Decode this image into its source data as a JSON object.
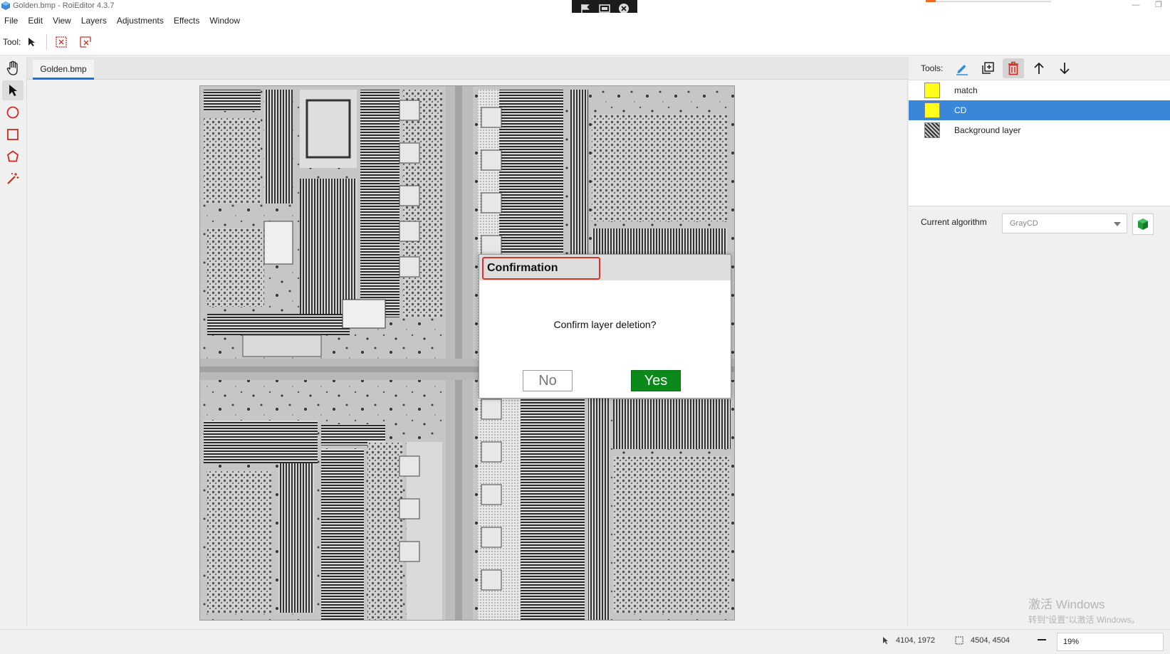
{
  "window": {
    "title": "Golden.bmp - RoiEditor 4.3.7"
  },
  "menubar": {
    "items": [
      "File",
      "Edit",
      "View",
      "Layers",
      "Adjustments",
      "Effects",
      "Window"
    ]
  },
  "toolbar": {
    "label": "Tool:"
  },
  "document": {
    "tab_label": "Golden.bmp"
  },
  "dialog": {
    "title": "Confirmation",
    "message": "Confirm layer deletion?",
    "no_label": "No",
    "yes_label": "Yes"
  },
  "right_panel": {
    "tools_label": "Tools:",
    "layers": [
      {
        "name": "match",
        "color": "#ffff1a",
        "selected": false
      },
      {
        "name": "CD",
        "color": "#ffff1a",
        "selected": true
      },
      {
        "name": "Background layer",
        "color": "#888888",
        "selected": false
      }
    ],
    "algorithm_label": "Current algorithm",
    "algorithm_value": "GrayCD"
  },
  "statusbar": {
    "cursor_position": "4104, 1972",
    "image_size": "4504, 4504",
    "zoom": "19%"
  },
  "watermark": {
    "line1": "激活 Windows",
    "line2": "转到\"设置\"以激活 Windows。"
  },
  "colors": {
    "accent": "#1b72d9",
    "selection": "#3a86d8",
    "yes_button": "#0b8a19",
    "dialog_title_border": "#d9362b",
    "delete_icon": "#d12a1f"
  }
}
